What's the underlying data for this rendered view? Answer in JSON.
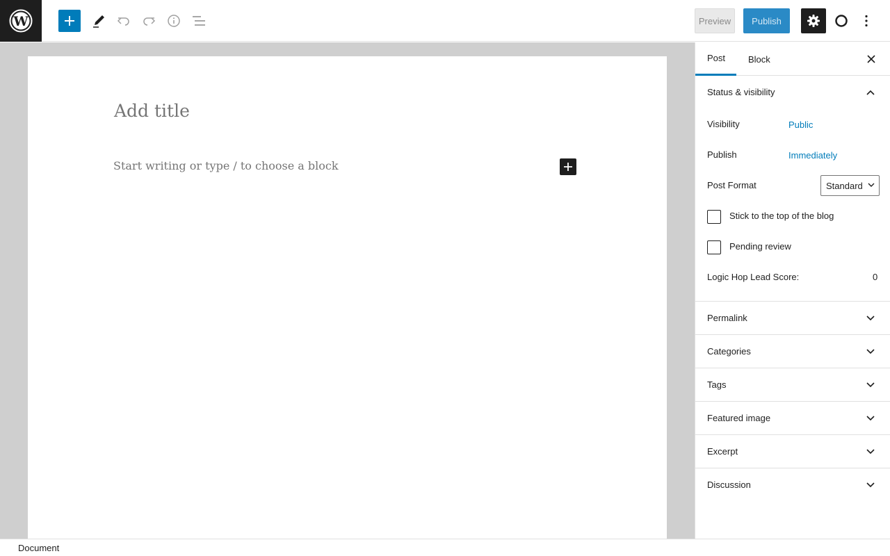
{
  "toolbar": {
    "preview_label": "Preview",
    "publish_label": "Publish"
  },
  "editor": {
    "title_placeholder": "Add title",
    "body_placeholder": "Start writing or type / to choose a block"
  },
  "sidebar": {
    "tabs": [
      {
        "label": "Post",
        "active": true
      },
      {
        "label": "Block",
        "active": false
      }
    ],
    "status_section": {
      "title": "Status & visibility",
      "visibility_label": "Visibility",
      "visibility_value": "Public",
      "publish_label": "Publish",
      "publish_value": "Immediately",
      "format_label": "Post Format",
      "format_value": "Standard",
      "stick_label": "Stick to the top of the blog",
      "stick_checked": false,
      "pending_label": "Pending review",
      "pending_checked": false,
      "score_label": "Logic Hop Lead Score:",
      "score_value": "0"
    },
    "panels": [
      {
        "title": "Permalink"
      },
      {
        "title": "Categories"
      },
      {
        "title": "Tags"
      },
      {
        "title": "Featured image"
      },
      {
        "title": "Excerpt"
      },
      {
        "title": "Discussion"
      }
    ]
  },
  "footer": {
    "breadcrumb": "Document"
  },
  "colors": {
    "accent": "#007cba",
    "dark": "#1e1e1e",
    "canvas": "#cfcfcf"
  },
  "icons": [
    "wordpress-logo-icon",
    "plus-icon",
    "pencil-icon",
    "undo-icon",
    "redo-icon",
    "info-icon",
    "list-view-icon",
    "gear-icon",
    "circle-plugin-icon",
    "more-vertical-icon",
    "close-icon",
    "chevron-up-icon",
    "chevron-down-icon"
  ]
}
